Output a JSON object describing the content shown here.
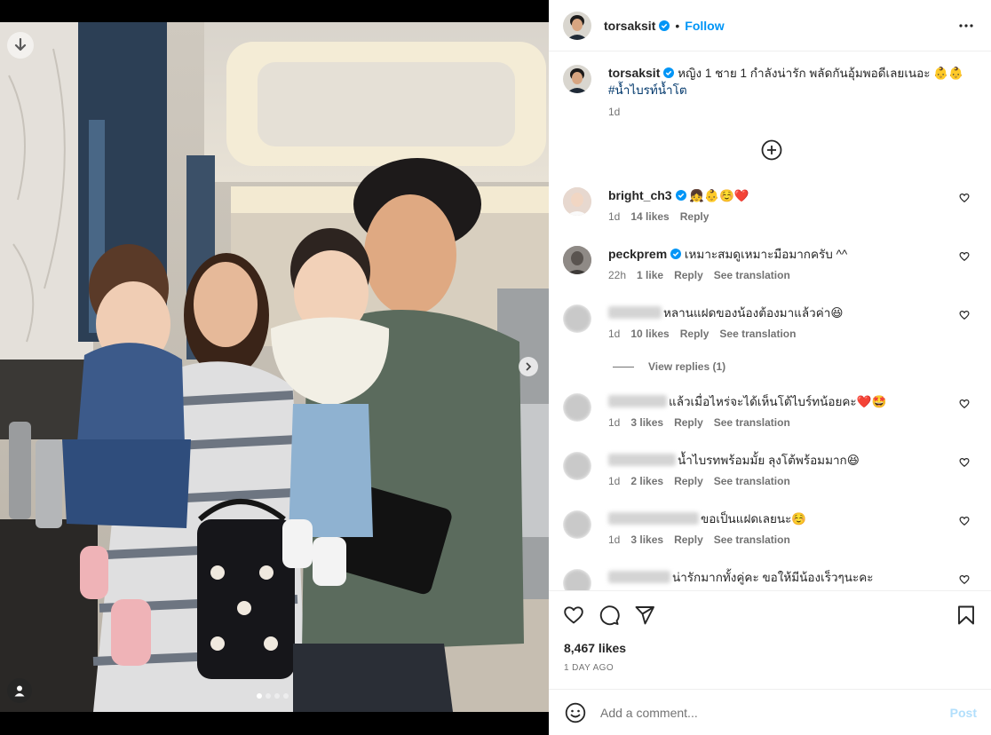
{
  "post": {
    "author": "torsaksit",
    "follow_label": "Follow",
    "separator": "•",
    "caption_text": "หญิง 1 ชาย 1 กำลังน่ารัก พลัดกันอุ้มพอดีเลยเนอะ 👶👶",
    "caption_hashtag": "#น้ำไบรท์น้ำโต",
    "caption_time": "1d",
    "likes": "8,467 likes",
    "time_ago": "1 DAY AGO"
  },
  "media": {
    "slide_count": 4,
    "active_slide": 1
  },
  "comments": [
    {
      "username": "bright_ch3",
      "verified": true,
      "text": "👧👶☺️❤️",
      "time": "1d",
      "likes": "14 likes",
      "reply": "Reply",
      "translate": ""
    },
    {
      "username": "peckprem",
      "verified": true,
      "text": "เหมาะสมดูเหมาะมือมากครับ ^^",
      "time": "22h",
      "likes": "1 like",
      "reply": "Reply",
      "translate": "See translation"
    },
    {
      "username": "",
      "verified": false,
      "text": "หลานแฝดของน้องต้องมาแล้วค่า😆",
      "time": "1d",
      "likes": "10 likes",
      "reply": "Reply",
      "translate": "See translation"
    },
    {
      "username": "",
      "verified": false,
      "text": "แล้วเมื่อไหร่จะได้เห็นโต้ไบร์ทน้อยคะ❤️🤩",
      "time": "1d",
      "likes": "3 likes",
      "reply": "Reply",
      "translate": "See translation"
    },
    {
      "username": "",
      "verified": false,
      "text": "น้ำไบรทพร้อมมั้ย ลุงโต้พร้อมมาก😆",
      "time": "1d",
      "likes": "2 likes",
      "reply": "Reply",
      "translate": "See translation"
    },
    {
      "username": "",
      "verified": false,
      "text": "ขอเป็นแฝดเลยนะ☺️",
      "time": "1d",
      "likes": "3 likes",
      "reply": "Reply",
      "translate": "See translation"
    },
    {
      "username": "",
      "verified": false,
      "text": "น่ารักมากทั้งคู่คะ ขอให้มีน้องเร็วๆนะคะ",
      "time": "",
      "likes": "",
      "reply": "",
      "translate": ""
    }
  ],
  "view_replies": "View replies (1)",
  "composer": {
    "placeholder": "Add a comment...",
    "post_label": "Post"
  },
  "colors": {
    "accent": "#0095f6",
    "verified": "#0095f6",
    "heart_red": "#ed4956"
  }
}
